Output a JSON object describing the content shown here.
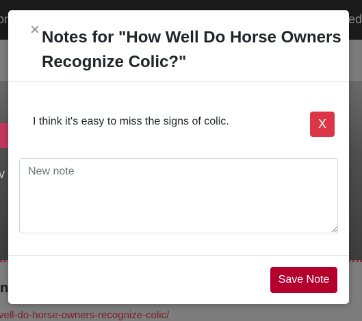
{
  "background": {
    "navbar_left_text": "on",
    "navbar_right_text": "ed",
    "hero_text": "v",
    "below_letter": "n",
    "link_text": "vell-do-horse-owners-recognize-colic/"
  },
  "modal": {
    "title": "Notes for \"How Well Do Horse Owners Recognize Colic?\"",
    "close_icon": "×",
    "notes": [
      {
        "text": "I think it's easy to miss the signs of colic.",
        "delete_label": "X"
      }
    ],
    "new_note": {
      "placeholder": "New note",
      "value": ""
    },
    "save_label": "Save Note"
  },
  "colors": {
    "accent": "#b5002e",
    "danger": "#dc3545"
  }
}
